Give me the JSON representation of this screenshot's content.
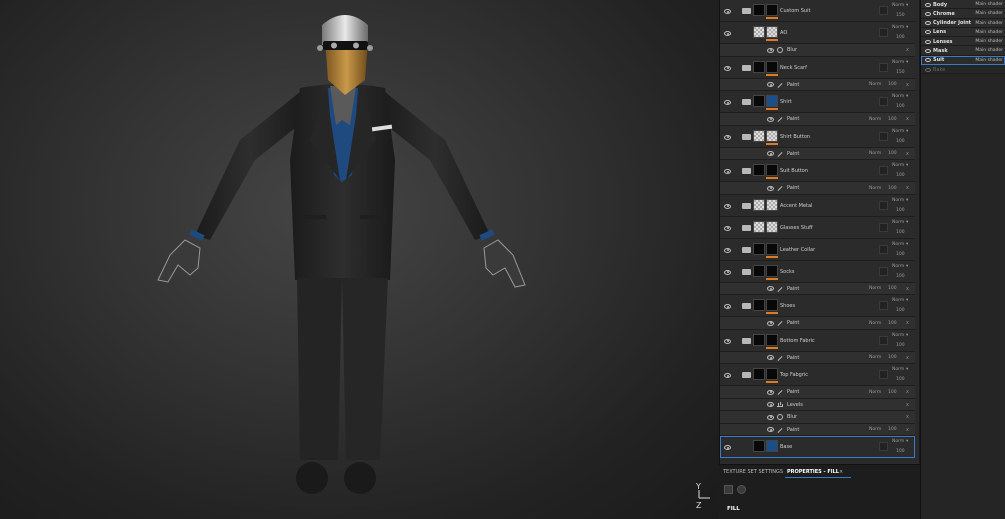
{
  "layers": [
    {
      "type": "layer",
      "name": "Custom Suit",
      "thumb": "dark",
      "folder": true,
      "blend": "Norm",
      "opacity": "150"
    },
    {
      "type": "layer",
      "name": "AO",
      "thumb": "checker",
      "folder": false,
      "blend": "Norm",
      "opacity": "100"
    },
    {
      "type": "effect",
      "name": "Blur",
      "icon": "gear-icon",
      "x": "x"
    },
    {
      "type": "layer",
      "name": "Neck Scarf",
      "thumb": "dark",
      "folder": true,
      "blend": "Norm",
      "opacity": "150"
    },
    {
      "type": "paint",
      "name": "Paint",
      "blend": "Norm",
      "opacity": "100",
      "x": "x"
    },
    {
      "type": "layer",
      "name": "Shirt",
      "thumb": "blue",
      "folder": true,
      "blend": "Norm",
      "opacity": "100"
    },
    {
      "type": "paint",
      "name": "Paint",
      "blend": "Norm",
      "opacity": "100",
      "x": "x"
    },
    {
      "type": "layer",
      "name": "Shirt Button",
      "thumb": "checker",
      "folder": true,
      "blend": "Norm",
      "opacity": "100"
    },
    {
      "type": "paint",
      "name": "Paint",
      "blend": "Norm",
      "opacity": "100",
      "x": "x"
    },
    {
      "type": "layer",
      "name": "Suit Button",
      "thumb": "dark",
      "folder": true,
      "blend": "Norm",
      "opacity": "100"
    },
    {
      "type": "paint",
      "name": "Paint",
      "blend": "Norm",
      "opacity": "100",
      "x": "x"
    },
    {
      "type": "layer",
      "name": "Accent Metal",
      "thumb": "checker",
      "folder": true,
      "blend": "Norm",
      "opacity": "100",
      "noOrange": true
    },
    {
      "type": "layer",
      "name": "Glasses Stuff",
      "thumb": "checker",
      "folder": true,
      "blend": "Norm",
      "opacity": "100",
      "noOrange": true
    },
    {
      "type": "layer",
      "name": "Leather Collar",
      "thumb": "dark",
      "folder": true,
      "blend": "Norm",
      "opacity": "100"
    },
    {
      "type": "layer",
      "name": "Socks",
      "thumb": "dark",
      "folder": true,
      "blend": "Norm",
      "opacity": "100"
    },
    {
      "type": "paint",
      "name": "Paint",
      "blend": "Norm",
      "opacity": "100",
      "x": "x"
    },
    {
      "type": "layer",
      "name": "Shoes",
      "thumb": "dark",
      "folder": true,
      "blend": "Norm",
      "opacity": "100"
    },
    {
      "type": "paint",
      "name": "Paint",
      "blend": "Norm",
      "opacity": "100",
      "x": "x"
    },
    {
      "type": "layer",
      "name": "Bottom Fabric",
      "thumb": "dark",
      "folder": true,
      "blend": "Norm",
      "opacity": "100"
    },
    {
      "type": "paint",
      "name": "Paint",
      "blend": "Norm",
      "opacity": "100",
      "x": "x"
    },
    {
      "type": "layer",
      "name": "Top Fabgric",
      "thumb": "dark",
      "folder": true,
      "blend": "Norm",
      "opacity": "100"
    },
    {
      "type": "paint",
      "name": "Paint",
      "blend": "Norm",
      "opacity": "100",
      "x": "x"
    },
    {
      "type": "effect",
      "name": "Levels",
      "icon": "levels-icon",
      "x": "x"
    },
    {
      "type": "effect",
      "name": "Blur",
      "icon": "gear-icon",
      "x": "x"
    },
    {
      "type": "paint",
      "name": "Paint",
      "blend": "Norm",
      "opacity": "100",
      "x": "x"
    },
    {
      "type": "layer",
      "name": "Base",
      "thumb": "blue",
      "folder": false,
      "blend": "Norm",
      "opacity": "100",
      "selected": true,
      "noOrange": true
    }
  ],
  "texture_sets": [
    {
      "name": "Body",
      "shader": "Main shader"
    },
    {
      "name": "Chrome",
      "shader": "Main shader"
    },
    {
      "name": "Cylinder Joint",
      "shader": "Main shader"
    },
    {
      "name": "Lens",
      "shader": "Main shader"
    },
    {
      "name": "Lenses",
      "shader": "Main shader"
    },
    {
      "name": "Mask",
      "shader": "Main shader"
    },
    {
      "name": "Suit",
      "shader": "Main shader",
      "selected": true
    },
    {
      "name": "Bake",
      "shader": "",
      "dim": true
    }
  ],
  "properties": {
    "tab_texture_set": "TEXTURE SET SETTINGS",
    "tab_properties": "PROPERTIES - FILL",
    "tab_close": "×",
    "fill_label": "FILL"
  },
  "viewport": {
    "axis_y": "Y",
    "axis_z": "Z",
    "suit_color": "#2a2a2a",
    "shirt_color": "#1e4a80",
    "mask_color": "#b8863a",
    "chrome_color": "#c8c8c8"
  }
}
